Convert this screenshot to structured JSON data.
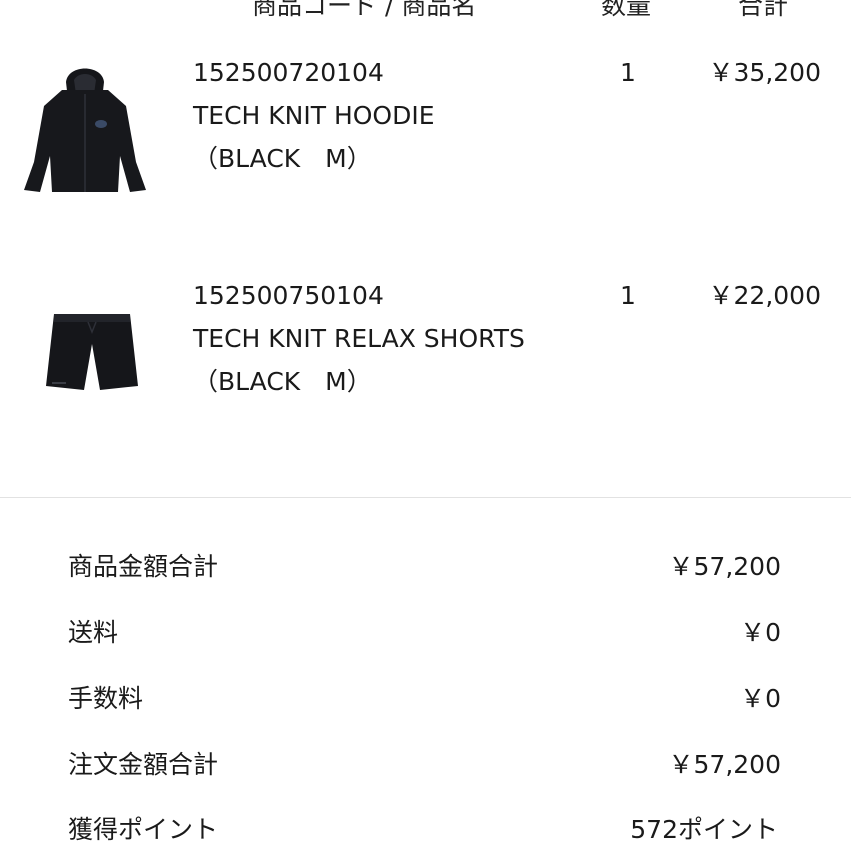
{
  "header": {
    "code_name": "商品コード / 商品名",
    "quantity": "数量",
    "total": "合計"
  },
  "items": [
    {
      "code": "152500720104",
      "name": "TECH KNIT HOODIE",
      "variant": "（BLACK　M）",
      "quantity": "1",
      "price": "￥35,200",
      "image_icon": "hoodie-icon"
    },
    {
      "code": "152500750104",
      "name": "TECH KNIT RELAX SHORTS",
      "variant": "（BLACK　M）",
      "quantity": "1",
      "price": "￥22,000",
      "image_icon": "shorts-icon"
    }
  ],
  "summary": [
    {
      "label": "商品金額合計",
      "value": "￥57,200"
    },
    {
      "label": "送料",
      "value": "￥0"
    },
    {
      "label": "手数料",
      "value": "￥0"
    },
    {
      "label": "注文金額合計",
      "value": "￥57,200"
    },
    {
      "label": "獲得ポイント",
      "value": "572ポイント"
    }
  ]
}
